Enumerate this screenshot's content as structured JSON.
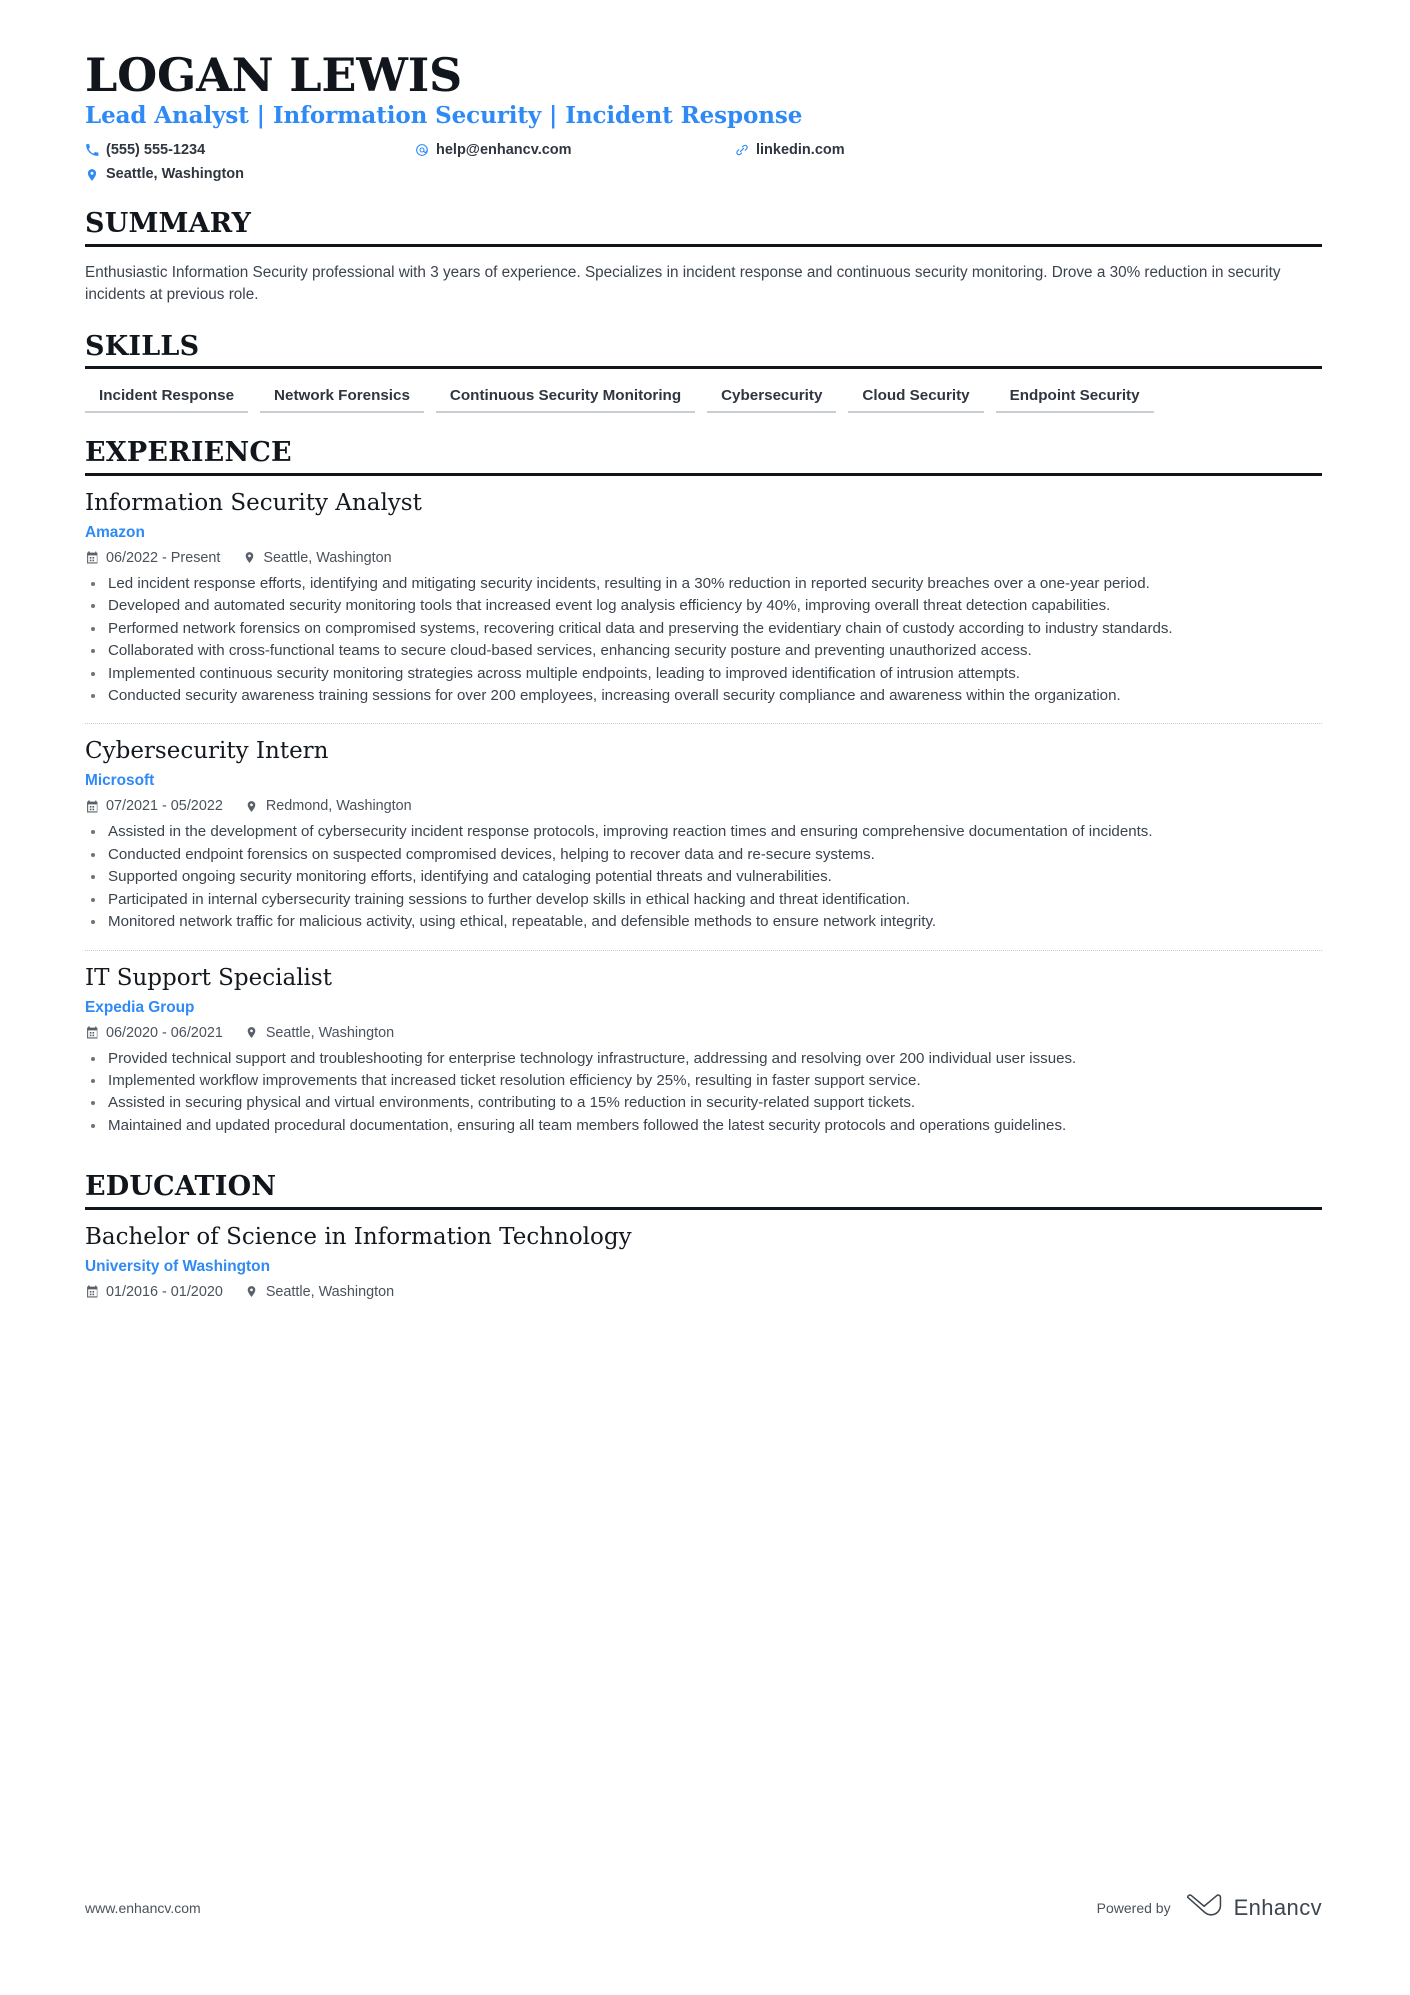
{
  "header": {
    "name": "LOGAN LEWIS",
    "headline": "Lead Analyst | Information Security | Incident Response",
    "contacts": [
      {
        "icon": "phone-icon",
        "text": "(555) 555-1234"
      },
      {
        "icon": "email-icon",
        "text": "help@enhancv.com"
      },
      {
        "icon": "link-icon",
        "text": "linkedin.com"
      },
      {
        "icon": "location-pin-icon",
        "text": "Seattle, Washington"
      }
    ]
  },
  "summary": {
    "heading": "SUMMARY",
    "text": "Enthusiastic Information Security professional with 3 years of experience. Specializes in incident response and continuous security monitoring. Drove a 30% reduction in security incidents at previous role."
  },
  "skills": {
    "heading": "SKILLS",
    "items": [
      "Incident Response",
      "Network Forensics",
      "Continuous Security Monitoring",
      "Cybersecurity",
      "Cloud Security",
      "Endpoint Security"
    ]
  },
  "experience": {
    "heading": "EXPERIENCE",
    "entries": [
      {
        "title": "Information Security Analyst",
        "company": "Amazon",
        "dates": "06/2022 - Present",
        "location": "Seattle, Washington",
        "bullets": [
          "Led incident response efforts, identifying and mitigating security incidents, resulting in a 30% reduction in reported security breaches over a one-year period.",
          "Developed and automated security monitoring tools that increased event log analysis efficiency by 40%, improving overall threat detection capabilities.",
          "Performed network forensics on compromised systems, recovering critical data and preserving the evidentiary chain of custody according to industry standards.",
          "Collaborated with cross-functional teams to secure cloud-based services, enhancing security posture and preventing unauthorized access.",
          "Implemented continuous security monitoring strategies across multiple endpoints, leading to improved identification of intrusion attempts.",
          "Conducted security awareness training sessions for over 200 employees, increasing overall security compliance and awareness within the organization."
        ]
      },
      {
        "title": "Cybersecurity Intern",
        "company": "Microsoft",
        "dates": "07/2021 - 05/2022",
        "location": "Redmond, Washington",
        "bullets": [
          "Assisted in the development of cybersecurity incident response protocols, improving reaction times and ensuring comprehensive documentation of incidents.",
          "Conducted endpoint forensics on suspected compromised devices, helping to recover data and re-secure systems.",
          "Supported ongoing security monitoring efforts, identifying and cataloging potential threats and vulnerabilities.",
          "Participated in internal cybersecurity training sessions to further develop skills in ethical hacking and threat identification.",
          "Monitored network traffic for malicious activity, using ethical, repeatable, and defensible methods to ensure network integrity."
        ]
      },
      {
        "title": "IT Support Specialist",
        "company": "Expedia Group",
        "dates": "06/2020 - 06/2021",
        "location": "Seattle, Washington",
        "bullets": [
          "Provided technical support and troubleshooting for enterprise technology infrastructure, addressing and resolving over 200 individual user issues.",
          "Implemented workflow improvements that increased ticket resolution efficiency by 25%, resulting in faster support service.",
          "Assisted in securing physical and virtual environments, contributing to a 15% reduction in security-related support tickets.",
          "Maintained and updated procedural documentation, ensuring all team members followed the latest security protocols and operations guidelines."
        ]
      }
    ]
  },
  "education": {
    "heading": "EDUCATION",
    "entries": [
      {
        "degree": "Bachelor of Science in Information Technology",
        "school": "University of Washington",
        "dates": "01/2016 - 01/2020",
        "location": "Seattle, Washington"
      }
    ]
  },
  "footer": {
    "url": "www.enhancv.com",
    "powered_by": "Powered by",
    "brand": "Enhancv"
  },
  "colors": {
    "accent_blue": "#2f8af5",
    "heading_black": "#11161c",
    "body_gray": "#3b434d",
    "rule_gray": "#c9ced4"
  }
}
